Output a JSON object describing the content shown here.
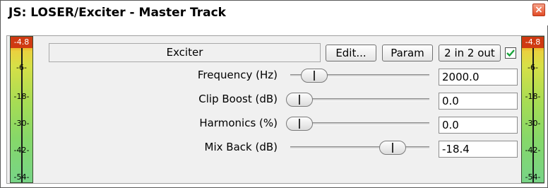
{
  "window": {
    "title": "JS: LOSER/Exciter - Master Track",
    "close_glyph": "×"
  },
  "plugin": {
    "name": "Exciter",
    "buttons": {
      "edit": "Edit...",
      "param": "Param",
      "io": "2 in 2 out"
    },
    "enabled": true
  },
  "meters": {
    "left": {
      "peak": "-4.8",
      "ticks": [
        "-6-",
        "-18-",
        "-30-",
        "-42-",
        "-54-"
      ]
    },
    "right": {
      "peak": "-4.8",
      "ticks": [
        "-6-",
        "-18-",
        "-30-",
        "-42-",
        "-54-"
      ]
    }
  },
  "params": [
    {
      "label": "Frequency (Hz)",
      "value": "2000.0",
      "slider_pos": 0.12
    },
    {
      "label": "Clip Boost (dB)",
      "value": "0.0",
      "slider_pos": 0.0
    },
    {
      "label": "Harmonics (%)",
      "value": "0.0",
      "slider_pos": 0.0
    },
    {
      "label": "Mix Back (dB)",
      "value": "-18.4",
      "slider_pos": 0.77
    }
  ],
  "colors": {
    "peak": "#cf3a12",
    "checkbox_check": "#19a33a"
  },
  "icons": {
    "close": "close-icon",
    "check": "checkmark-icon"
  }
}
